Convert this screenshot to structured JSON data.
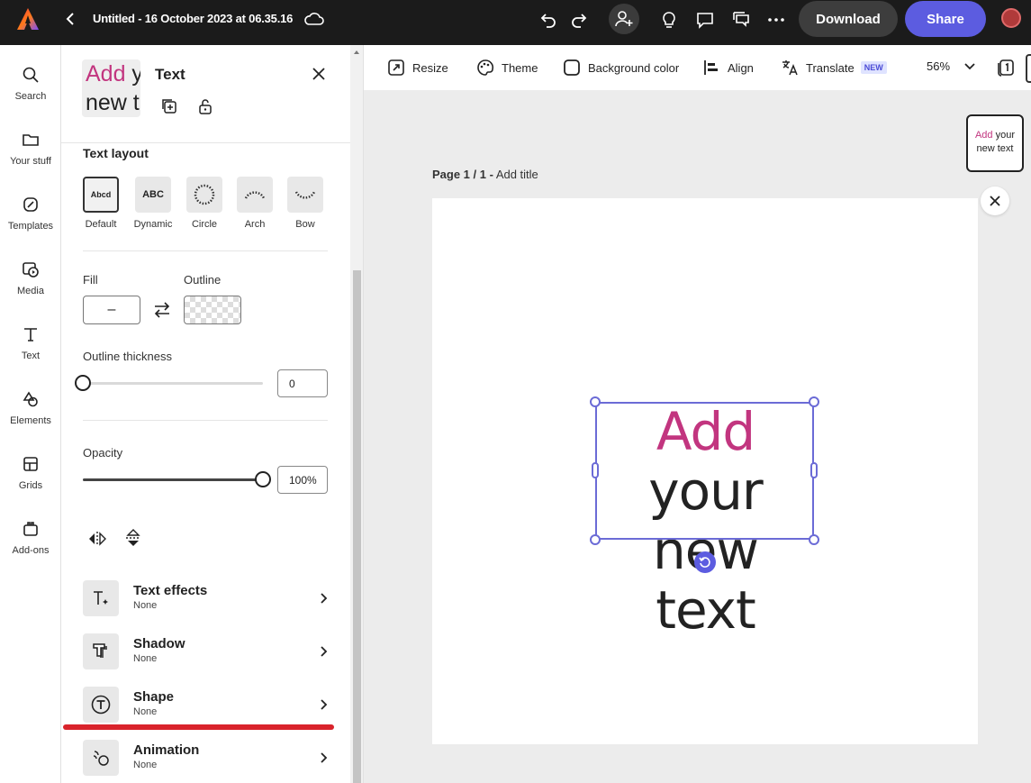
{
  "topbar": {
    "doc_title": "Untitled - 16 October 2023 at 06.35.16",
    "download_label": "Download",
    "share_label": "Share"
  },
  "rail": {
    "items": [
      {
        "label": "Search",
        "icon": "search-icon"
      },
      {
        "label": "Your stuff",
        "icon": "folder-icon"
      },
      {
        "label": "Templates",
        "icon": "templates-icon"
      },
      {
        "label": "Media",
        "icon": "media-icon"
      },
      {
        "label": "Text",
        "icon": "text-icon"
      },
      {
        "label": "Elements",
        "icon": "elements-icon"
      },
      {
        "label": "Grids",
        "icon": "grids-icon"
      },
      {
        "label": "Add-ons",
        "icon": "addons-icon"
      }
    ]
  },
  "panel": {
    "preview_word1": "Add",
    "preview_rest_line1": " y",
    "preview_line2": "new t",
    "title": "Text",
    "text_layout_label": "Text layout",
    "layouts": [
      {
        "label": "Default",
        "sample": "Abcd"
      },
      {
        "label": "Dynamic",
        "sample": "ABC"
      },
      {
        "label": "Circle",
        "sample": ""
      },
      {
        "label": "Arch",
        "sample": ""
      },
      {
        "label": "Bow",
        "sample": ""
      }
    ],
    "fill_label": "Fill",
    "fill_value": "–",
    "outline_label": "Outline",
    "outline_thickness_label": "Outline thickness",
    "outline_thickness_value": "0",
    "outline_thickness_fraction": 0.0,
    "opacity_label": "Opacity",
    "opacity_value": "100%",
    "opacity_fraction": 1.0,
    "effects": [
      {
        "name": "Text effects",
        "value": "None",
        "icon": "text-effects-icon"
      },
      {
        "name": "Shadow",
        "value": "None",
        "icon": "shadow-icon"
      },
      {
        "name": "Shape",
        "value": "None",
        "icon": "shape-icon"
      },
      {
        "name": "Animation",
        "value": "None",
        "icon": "animation-icon"
      }
    ]
  },
  "canvas_toolbar": {
    "resize": "Resize",
    "theme": "Theme",
    "background_color": "Background color",
    "align": "Align",
    "translate": "Translate",
    "new_badge": "NEW",
    "zoom": "56%"
  },
  "canvas": {
    "page_label_bold": "Page 1 / 1 -",
    "page_label_rest": " Add title",
    "text_word1": "Add",
    "text_rest_line1": " your",
    "text_line2": "new text",
    "thumb_word1": "Add",
    "thumb_rest": " your",
    "thumb_line2": "new text"
  },
  "colors": {
    "accent": "#5c5ce0",
    "text_highlight": "#c2357f",
    "annotation_red": "#d9232b"
  }
}
